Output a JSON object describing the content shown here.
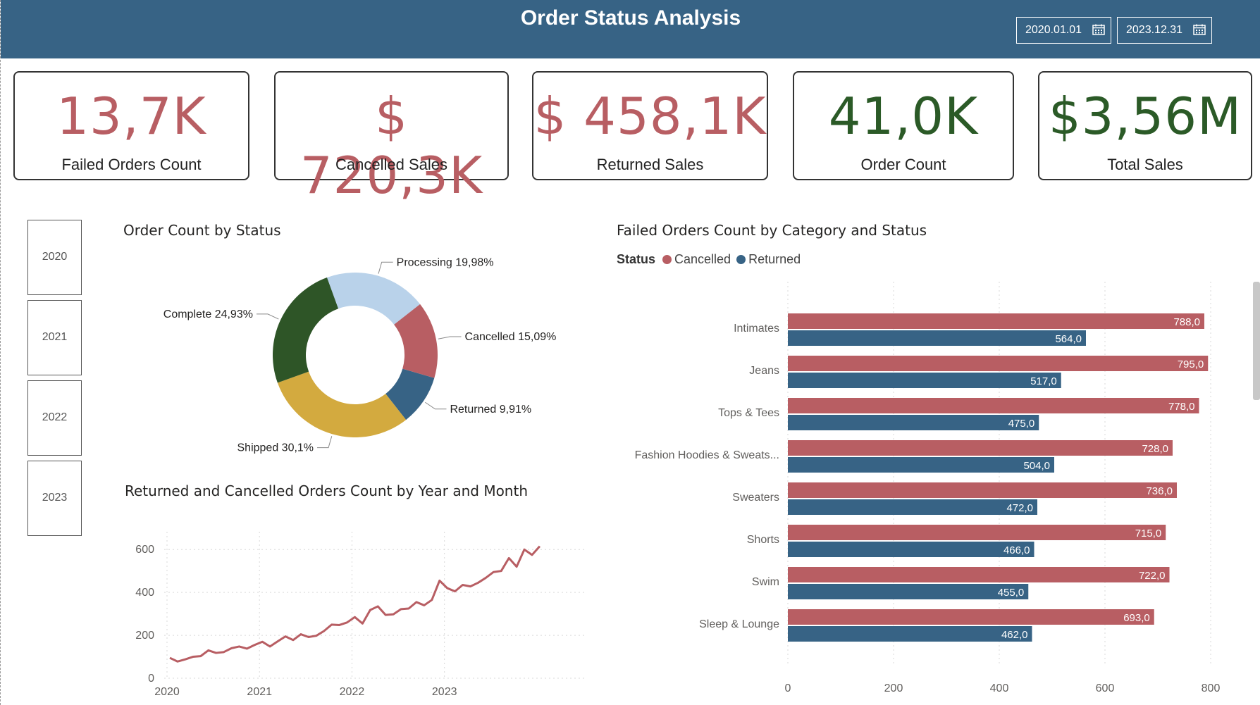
{
  "header": {
    "title": "Order Status Analysis",
    "start_date": "2020.01.01",
    "end_date": "2023.12.31",
    "calendar_icon": "calendar-icon",
    "background": "#376385"
  },
  "kpis": [
    {
      "value": "13,7K",
      "label": "Failed Orders Count",
      "color": "#b85e63"
    },
    {
      "value": "$ 720,3K",
      "label": "Cancelled Sales",
      "color": "#b85e63"
    },
    {
      "value": "$ 458,1K",
      "label": "Returned Sales",
      "color": "#b85e63"
    },
    {
      "value": "41,0K",
      "label": "Order Count",
      "color": "#2b5a27"
    },
    {
      "value": "$3,56M",
      "label": "Total Sales",
      "color": "#2b5a27"
    }
  ],
  "year_slicer": [
    "2020",
    "2021",
    "2022",
    "2023"
  ],
  "donut": {
    "title": "Order Count by Status"
  },
  "line": {
    "title": "Returned and Cancelled Orders Count by Year and Month"
  },
  "bars": {
    "title": "Failed Orders Count by Category and Status",
    "legend_title": "Status",
    "legend_items": [
      "Cancelled",
      "Returned"
    ]
  },
  "chart_data": [
    {
      "type": "pie",
      "variant": "donut",
      "title": "Order Count by Status",
      "slices": [
        {
          "label": "Processing 19,98%",
          "value": 19.98,
          "color": "#b9d2ea"
        },
        {
          "label": "Cancelled 15,09%",
          "value": 15.09,
          "color": "#b85e63"
        },
        {
          "label": "Returned 9,91%",
          "value": 9.91,
          "color": "#376385"
        },
        {
          "label": "Shipped 30,1%",
          "value": 30.1,
          "color": "#d3aa3f"
        },
        {
          "label": "Complete 24,93%",
          "value": 24.93,
          "color": "#2e5527"
        }
      ]
    },
    {
      "type": "line",
      "title": "Returned and Cancelled Orders Count by Year and Month",
      "x_ticks": [
        "2020",
        "2021",
        "2022",
        "2023"
      ],
      "y_ticks": [
        "0",
        "200",
        "400",
        "600"
      ],
      "ylim": [
        0,
        650
      ],
      "grid": true,
      "color": "#b85e63",
      "values": [
        95,
        78,
        88,
        100,
        103,
        130,
        118,
        122,
        140,
        148,
        138,
        155,
        170,
        148,
        172,
        195,
        178,
        205,
        192,
        198,
        220,
        250,
        248,
        260,
        285,
        255,
        318,
        335,
        295,
        298,
        322,
        325,
        355,
        340,
        365,
        455,
        420,
        405,
        435,
        428,
        445,
        468,
        495,
        500,
        560,
        520,
        600,
        575,
        615
      ]
    },
    {
      "type": "bar",
      "orientation": "horizontal",
      "title": "Failed Orders Count by Category and Status",
      "categories": [
        "Intimates",
        "Jeans",
        "Tops & Tees",
        "Fashion Hoodies & Sweats...",
        "Sweaters",
        "Shorts",
        "Swim",
        "Sleep & Lounge"
      ],
      "series": [
        {
          "name": "Cancelled",
          "color": "#b85e63",
          "values": [
            788,
            795,
            778,
            728,
            736,
            715,
            722,
            693
          ],
          "labels": [
            "788,0",
            "795,0",
            "778,0",
            "728,0",
            "736,0",
            "715,0",
            "722,0",
            "693,0"
          ]
        },
        {
          "name": "Returned",
          "color": "#376385",
          "values": [
            564,
            517,
            475,
            504,
            472,
            466,
            455,
            462
          ],
          "labels": [
            "564,0",
            "517,0",
            "475,0",
            "504,0",
            "472,0",
            "466,0",
            "455,0",
            "462,0"
          ]
        }
      ],
      "x_ticks": [
        "0",
        "200",
        "400",
        "600",
        "800"
      ],
      "xlim": [
        0,
        800
      ],
      "grid": true,
      "legend": "top-left"
    }
  ]
}
